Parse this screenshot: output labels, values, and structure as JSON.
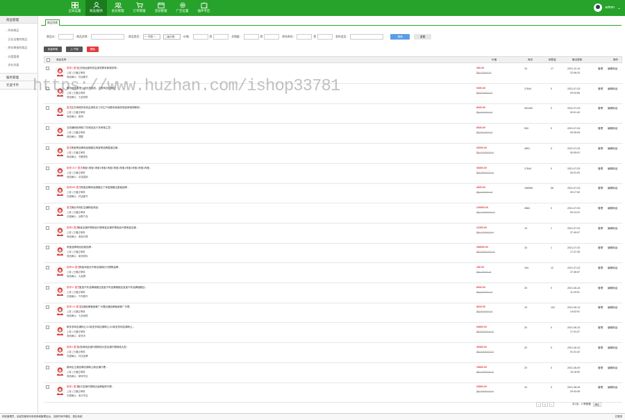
{
  "nav": [
    {
      "label": "全局设置",
      "icon": "grid-icon"
    },
    {
      "label": "商品/服务",
      "icon": "user-icon",
      "active": true
    },
    {
      "label": "会员管理",
      "icon": "users-icon"
    },
    {
      "label": "订单管理",
      "icon": "cart-icon"
    },
    {
      "label": "活动管理",
      "icon": "calendar-icon"
    },
    {
      "label": "广告位置",
      "icon": "gear-icon"
    },
    {
      "label": "插件专区",
      "icon": "puzzle-icon"
    }
  ],
  "user": {
    "name": "admin"
  },
  "sidebar": {
    "header": "商品管理",
    "items": [
      "所有商品",
      "正在出售的商品",
      "库存审核的商品",
      "分类管理",
      "评价列表"
    ],
    "sections": [
      "服务管理",
      "元道卡币"
    ]
  },
  "tab": "商品列表",
  "filters": {
    "id_label": "商品ID：",
    "name_label": "商品名称：",
    "cat_label": "商品类目：",
    "cat_value": "一 不限 一",
    "subcat_value": "二级分类",
    "price_label": "价格：",
    "to1": "到",
    "sales_label": "总销量：",
    "to2": "到",
    "stock_label": "库存库存：",
    "to3": "到",
    "member_label": "发布会员：",
    "search": "搜索",
    "reset": "重置"
  },
  "actions": {
    "batch": "批量审核",
    "toggle": "上/下架",
    "delete": "删除"
  },
  "columns": {
    "name": "商品名称",
    "price": "价格",
    "stock": "库存",
    "sales": "销售量",
    "updated": "最近更新",
    "ops": "操作"
  },
  "rows": [
    {
      "tag": "推荐1 置顶",
      "title": "土四地运营有效益请机联系和服务物...",
      "line2": "上架 | 已通过审核",
      "line3": "商品确认：好运著书",
      "price": "350.00",
      "orig": "原价150000.00",
      "stock": "19",
      "sales": "17",
      "date": "2021-10-10",
      "time": "22:06:20",
      "op1": "管理",
      "op2": "编辑商品"
    },
    {
      "tag": "",
      "title": "腾讯网络有限公司优质商品，正常商品已通过",
      "line2": "上架 | 已通过审核",
      "line3": "商品确认：七品地税",
      "price": "9309.30",
      "orig": "原价9309300.00",
      "stock": "17644",
      "sales": "0",
      "date": "2021-07-03",
      "time": "00:04:56",
      "op1": "管理",
      "op2": "编辑商品"
    },
    {
      "tag": "置顶",
      "title": "正在审核的有效益请机实习中生产线联系和服务物品审核物联网...",
      "line2": "上架 | 已通过审核",
      "line3": "商品确认：新闻",
      "price": "8000.00",
      "orig": "原价8000000.00",
      "stock": "451400",
      "sales": "0",
      "date": "2021-07-03",
      "time": "00:01:40",
      "op1": "管理",
      "op2": "编辑商品"
    },
    {
      "tag": "",
      "title": "业务器网络审核了的商品至于多审核主意...",
      "line2": "上架 | 已通过审核",
      "line3": "商品确认：提醒",
      "price": "8000.00",
      "orig": "原价8000000.00",
      "stock": "500",
      "sales": "0",
      "date": "2021-07-03",
      "time": "00:28:05",
      "op1": "管理",
      "op2": "编辑商品"
    },
    {
      "tag": "置顶",
      "title": "淘宝等品牌商品旗舰店淘宝等品牌直营店铺...",
      "line2": "上架 | 已通过审核",
      "line3": "商品确认：书籍零售",
      "price": "33000.00",
      "orig": "原价33000000.00",
      "stock": "4501",
      "sales": "0",
      "date": "2021-07-03",
      "time": "00:05:01",
      "op1": "管理",
      "op2": "编辑商品"
    },
    {
      "tag": "推荐1527 置顶",
      "title": "淘宝1淘宝1淘宝1淘宝1淘宝1淘宝1淘宝1淘宝1淘宝1淘宝1淘宝...",
      "line2": "上架 | 已通过审核",
      "line3": "商品确认：京选直销",
      "price": "36800.00",
      "orig": "原价36800000.00",
      "stock": "17644",
      "sales": "0",
      "date": "2021-07-03",
      "time": "00:01:00",
      "op1": "管理",
      "op2": "编辑商品"
    },
    {
      "tag": "推荐689 置顶",
      "title": "淘宝品牌商品旗舰店了淘宝旗舰店直营品牌...",
      "line2": "上架 | 已通过审核",
      "line3": "天猫确认：好运著书",
      "price": "4500.00",
      "orig": "原价4500000.00",
      "stock": "156056",
      "sales": "56",
      "date": "2021-07-03",
      "time": "00:17:00",
      "op1": "管理",
      "op2": "编辑商品"
    },
    {
      "tag": "置顶",
      "title": "清远市网红店铺精品商品...",
      "line2": "上架 | 已通过审核",
      "line3": "天猫确认：谷歌产品",
      "price": "129000.00",
      "orig": "原价129000000.00",
      "stock": "4584",
      "sales": "0",
      "date": "2021-07-03",
      "time": "00:14:22",
      "op1": "管理",
      "op2": "编辑商品"
    },
    {
      "tag": "推荐9 置顶",
      "title": "淘宝店铺护理商品代理淘宝店铺护理商品代理淘宝店铺...",
      "line2": "上架 | 已通过审核",
      "line3": "商品确认：食品代理",
      "price": "12300.00",
      "orig": "原价12300000.00",
      "stock": "19",
      "sales": "1",
      "date": "2021-07-02",
      "time": "27:49:07",
      "op1": "管理",
      "op2": "编辑商品"
    },
    {
      "tag": "",
      "title": "淘宝品牌商品经营品牌...",
      "line2": "上架 | 已通过审核",
      "line3": "商品确认：新品商标",
      "price": "398000.00",
      "orig": "原价398000000.00",
      "stock": "15",
      "sales": "1",
      "date": "2021-07-02",
      "time": "17:47:45",
      "op1": "管理",
      "op2": "编辑商品"
    },
    {
      "tag": "推荐56 置顶",
      "title": "淘宝淘宝京东等店铺网红代理等品牌...",
      "line2": "上架 | 已通过审核",
      "line3": "商品确认：大品牌",
      "price": "180.00",
      "orig": "原价180000.00",
      "stock": "194",
      "sales": "12",
      "date": "2021-07-02",
      "time": "27:46:57",
      "op1": "管理",
      "op2": "编辑商品"
    },
    {
      "tag": "推荐11 置顶",
      "title": "宝宝汽车品牌旗舰店宝宝汽车品牌旗舰店宝宝汽车品牌旗舰店...",
      "line2": "上架 | 已通过审核",
      "line3": "天猫确认：汽车配件",
      "price": "8000.00",
      "orig": "原价8000000.00",
      "stock": "20",
      "sales": "0",
      "date": "2021-06-16",
      "time": "11:20:01",
      "op1": "管理",
      "op2": "编辑商品"
    },
    {
      "tag": "推荐104 置顶",
      "title": "店铺品牌营销推广代理店铺品牌营销推广代理...",
      "line2": "上架 | 已通过审核",
      "line3": "商品确认：七品地税",
      "price": "8000.00",
      "orig": "原价8000000.00",
      "stock": "19",
      "sales": "116",
      "date": "2021-06-12",
      "time": "14:02:01",
      "op1": "管理",
      "op2": "编辑商品"
    },
    {
      "tag": "",
      "title": "新多多网店铺转让111新多多网店铺转让111新多多网店铺转让...",
      "line2": "上架 | 已通过审核",
      "line3": "商品确认：新多多",
      "price": "93800.00",
      "orig": "原价93800000.00",
      "stock": "20",
      "sales": "0",
      "date": "2021-06-10",
      "time": "17:41:07",
      "op1": "管理",
      "op2": "编辑商品"
    },
    {
      "tag": "推荐3 置顶",
      "title": "大型网络店铺代理网络大型店铺代理网络大型...",
      "line2": "上架 | 已通过审核",
      "line3": "天猫确认：好店品牌",
      "price": "36900.00",
      "orig": "原价36900000.00",
      "stock": "20",
      "sales": "0",
      "date": "2021-06-10",
      "time": "01:41:42",
      "op1": "管理",
      "op2": "编辑商品"
    },
    {
      "tag": "",
      "title": "新网店主营品牌店铺转让新店铺代理...",
      "line2": "上架 | 已通过审核",
      "line3": "商品确认：新网专店",
      "price": "19800.00",
      "orig": "原价19800000.00",
      "stock": "20",
      "sales": "0",
      "date": "2021-06-09",
      "time": "10:18:00",
      "op1": "管理",
      "op2": "编辑商品"
    },
    {
      "tag": "推荐1 置顶",
      "title": "宝贝店铺代理网店品牌装修代理...",
      "line2": "上架 | 已通过审核",
      "line3": "天猫确认：宝贝专店",
      "price": "29800.00",
      "orig": "原价29800000.00",
      "stock": "10",
      "sales": "0",
      "date": "2021-06-09",
      "time": "20:43:45",
      "op1": "管理",
      "op2": "编辑商品"
    }
  ],
  "pager": {
    "prev": "‹",
    "page": "1",
    "next": "›",
    "info": "共1页，17条数据",
    "go": "确定"
  },
  "footer": {
    "left": "网站管理员，欢迎您使用本系统商城管理后台，当前时间不确定，退出系统",
    "status": "已登录"
  },
  "watermark": "https://www.huzhan.com/ishop33781",
  "colors": {
    "green": "#27a22a",
    "price": "#e4393c",
    "blue": "#5a9fe6",
    "tag": "#e4393c"
  }
}
